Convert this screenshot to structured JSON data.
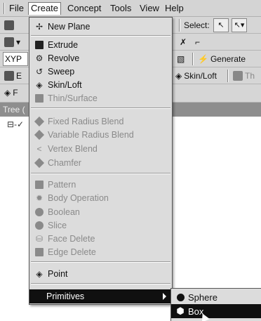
{
  "menubar": {
    "items": [
      "File",
      "Create",
      "Concept",
      "Tools",
      "View",
      "Help"
    ]
  },
  "toolbar": {
    "select_label": "Select:",
    "plane_value": "XYP",
    "generate_label": "Generate",
    "skin_loft_label": "Skin/Loft",
    "th_label": "Th",
    "e_label": "E",
    "f_label": "F"
  },
  "tree": {
    "header": "Tree (",
    "root_node": "⊟-✓"
  },
  "create_menu": {
    "items": [
      {
        "label": "New Plane",
        "icon": "new-plane-icon",
        "disabled": false
      },
      {
        "label": "Extrude",
        "icon": "extrude-icon",
        "disabled": false
      },
      {
        "label": "Revolve",
        "icon": "revolve-icon",
        "disabled": false
      },
      {
        "label": "Sweep",
        "icon": "sweep-icon",
        "disabled": false
      },
      {
        "label": "Skin/Loft",
        "icon": "skin-loft-icon",
        "disabled": false
      },
      {
        "label": "Thin/Surface",
        "icon": "thin-surface-icon",
        "disabled": true
      },
      {
        "label": "Fixed Radius Blend",
        "icon": "fixed-radius-blend-icon",
        "disabled": true
      },
      {
        "label": "Variable Radius Blend",
        "icon": "variable-radius-blend-icon",
        "disabled": true
      },
      {
        "label": "Vertex Blend",
        "icon": "vertex-blend-icon",
        "disabled": true
      },
      {
        "label": "Chamfer",
        "icon": "chamfer-icon",
        "disabled": true
      },
      {
        "label": "Pattern",
        "icon": "pattern-icon",
        "disabled": true
      },
      {
        "label": "Body Operation",
        "icon": "body-operation-icon",
        "disabled": true
      },
      {
        "label": "Boolean",
        "icon": "boolean-icon",
        "disabled": true
      },
      {
        "label": "Slice",
        "icon": "slice-icon",
        "disabled": true
      },
      {
        "label": "Face Delete",
        "icon": "face-delete-icon",
        "disabled": true
      },
      {
        "label": "Edge Delete",
        "icon": "edge-delete-icon",
        "disabled": true
      },
      {
        "label": "Point",
        "icon": "point-icon",
        "disabled": false
      },
      {
        "label": "Primitives",
        "icon": "",
        "disabled": false
      }
    ]
  },
  "primitives_submenu": {
    "items": [
      {
        "label": "Sphere",
        "icon": "sphere-icon"
      },
      {
        "label": "Box",
        "icon": "box-icon"
      }
    ]
  },
  "colors": {
    "highlight": "#101010",
    "disabled_text": "#8a8a8a",
    "menu_bg": "#dcdcdc"
  }
}
